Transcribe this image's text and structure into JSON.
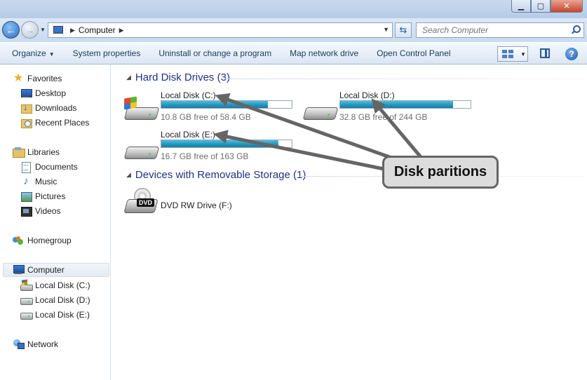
{
  "address": {
    "crumb": "Computer",
    "search_placeholder": "Search Computer"
  },
  "toolbar": {
    "organize": "Organize",
    "system_properties": "System properties",
    "uninstall": "Uninstall or change a program",
    "map_network": "Map network drive",
    "control_panel": "Open Control Panel"
  },
  "sidebar": {
    "favorites": "Favorites",
    "desktop": "Desktop",
    "downloads": "Downloads",
    "recent_places": "Recent Places",
    "libraries": "Libraries",
    "documents": "Documents",
    "music": "Music",
    "pictures": "Pictures",
    "videos": "Videos",
    "homegroup": "Homegroup",
    "computer": "Computer",
    "disk_c": "Local Disk (C:)",
    "disk_d": "Local Disk (D:)",
    "disk_e": "Local Disk (E:)",
    "network": "Network"
  },
  "main": {
    "hard_disk_header": "Hard Disk Drives (3)",
    "removable_header": "Devices with Removable Storage (1)",
    "drives": [
      {
        "name": "Local Disk (C:)",
        "free": "10.8 GB free of 58.4 GB",
        "used_fraction": 0.815
      },
      {
        "name": "Local Disk (D:)",
        "free": "32.8 GB free of 244 GB",
        "used_fraction": 0.866
      },
      {
        "name": "Local Disk (E:)",
        "free": "16.7 GB free of 163 GB",
        "used_fraction": 0.898
      }
    ],
    "dvd": {
      "name": "DVD RW Drive (F:)",
      "label": "DVD"
    }
  },
  "callout": {
    "text": "Disk paritions"
  },
  "colors": {
    "bar_fill": "#2596bd",
    "header_blue": "#1e3287",
    "callout_border": "#656565"
  }
}
